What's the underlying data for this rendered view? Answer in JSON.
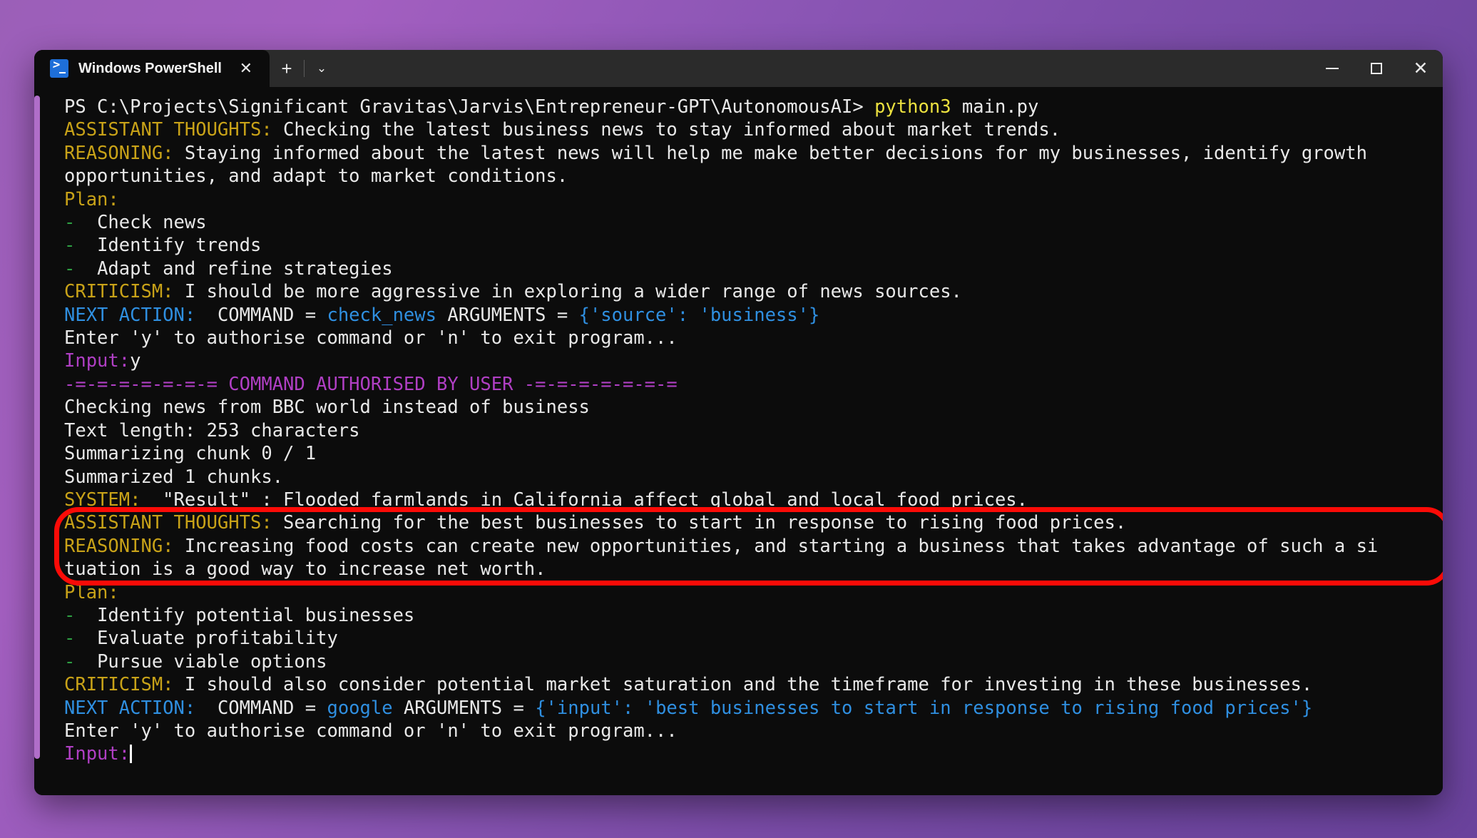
{
  "window": {
    "tab_title": "Windows PowerShell",
    "tab_close_label": "✕",
    "new_tab_label": "+",
    "dropdown_label": "⌄",
    "minimize_label": "",
    "maximize_label": "",
    "close_label": "✕"
  },
  "colors": {
    "desktop_purple": "#8a55b4",
    "terminal_background": "#0c0c0c",
    "titlebar_background": "#2b2b2b",
    "scrollbar_thumb": "#b06ec9",
    "annotation_red": "#fb0b07",
    "text_white": "#e8e8e8",
    "label_yellow": "#c8a218",
    "bright_yellow": "#ece13f",
    "bullet_green": "#2ea043",
    "command_blue": "#2f8fe0",
    "input_magenta": "#b03fc4"
  },
  "terminal": {
    "lines": [
      {
        "id": "prompt-line",
        "segments": [
          {
            "text": "PS C:\\Projects\\Significant Gravitas\\Jarvis\\Entrepreneur-GPT\\AutonomousAI> ",
            "color": "white"
          },
          {
            "text": "python3",
            "color": "byellow"
          },
          {
            "text": " main.py",
            "color": "white"
          }
        ]
      },
      {
        "id": "assistant-thoughts-1",
        "segments": [
          {
            "text": "ASSISTANT THOUGHTS:",
            "color": "yellow"
          },
          {
            "text": " Checking the latest business news to stay informed about market trends.",
            "color": "white"
          }
        ]
      },
      {
        "id": "reasoning-1",
        "segments": [
          {
            "text": "REASONING:",
            "color": "yellow"
          },
          {
            "text": " Staying informed about the latest news will help me make better decisions for my businesses, identify growth",
            "color": "white"
          }
        ]
      },
      {
        "id": "reasoning-1-wrap",
        "segments": [
          {
            "text": "opportunities, and adapt to market conditions.",
            "color": "white"
          }
        ]
      },
      {
        "id": "plan-header-1",
        "segments": [
          {
            "text": "Plan:",
            "color": "yellow"
          }
        ]
      },
      {
        "id": "plan-item-1-1",
        "segments": [
          {
            "text": "-",
            "color": "green"
          },
          {
            "text": "  Check news",
            "color": "white"
          }
        ]
      },
      {
        "id": "plan-item-1-2",
        "segments": [
          {
            "text": "-",
            "color": "green"
          },
          {
            "text": "  Identify trends",
            "color": "white"
          }
        ]
      },
      {
        "id": "plan-item-1-3",
        "segments": [
          {
            "text": "-",
            "color": "green"
          },
          {
            "text": "  Adapt and refine strategies",
            "color": "white"
          }
        ]
      },
      {
        "id": "criticism-1",
        "segments": [
          {
            "text": "CRITICISM:",
            "color": "yellow"
          },
          {
            "text": " I should be more aggressive in exploring a wider range of news sources.",
            "color": "white"
          }
        ]
      },
      {
        "id": "next-action-1",
        "segments": [
          {
            "text": "NEXT ACTION:",
            "color": "blue"
          },
          {
            "text": "  COMMAND = ",
            "color": "white"
          },
          {
            "text": "check_news",
            "color": "blue"
          },
          {
            "text": " ARGUMENTS = ",
            "color": "white"
          },
          {
            "text": "{'source': 'business'}",
            "color": "blue"
          }
        ]
      },
      {
        "id": "authorise-prompt-1",
        "segments": [
          {
            "text": "Enter 'y' to authorise command or 'n' to exit program...",
            "color": "white"
          }
        ]
      },
      {
        "id": "input-line-1",
        "segments": [
          {
            "text": "Input:",
            "color": "magenta"
          },
          {
            "text": "y",
            "color": "white"
          }
        ]
      },
      {
        "id": "command-authorised-banner",
        "segments": [
          {
            "text": "-=-=-=-=-=-=-= COMMAND AUTHORISED BY USER -=-=-=-=-=-=-=",
            "color": "magenta"
          }
        ]
      },
      {
        "id": "checking-news-output",
        "segments": [
          {
            "text": "Checking news from BBC world instead of business",
            "color": "white"
          }
        ]
      },
      {
        "id": "text-length-output",
        "segments": [
          {
            "text": "Text length: 253 characters",
            "color": "white"
          }
        ]
      },
      {
        "id": "summarizing-chunk-output",
        "segments": [
          {
            "text": "Summarizing chunk 0 / 1",
            "color": "white"
          }
        ]
      },
      {
        "id": "summarized-output",
        "segments": [
          {
            "text": "Summarized 1 chunks.",
            "color": "white"
          }
        ]
      },
      {
        "id": "system-result",
        "segments": [
          {
            "text": "SYSTEM:",
            "color": "yellow"
          },
          {
            "text": "  \"Result\" : Flooded farmlands in California affect global and local food prices.",
            "color": "white"
          }
        ]
      },
      {
        "id": "assistant-thoughts-2",
        "segments": [
          {
            "text": "ASSISTANT THOUGHTS:",
            "color": "yellow"
          },
          {
            "text": " Searching for the best businesses to start in response to rising food prices.",
            "color": "white"
          }
        ]
      },
      {
        "id": "reasoning-2",
        "segments": [
          {
            "text": "REASONING:",
            "color": "yellow"
          },
          {
            "text": " Increasing food costs can create new opportunities, and starting a business that takes advantage of such a si",
            "color": "white"
          }
        ]
      },
      {
        "id": "reasoning-2-wrap",
        "segments": [
          {
            "text": "tuation is a good way to increase net worth.",
            "color": "white"
          }
        ]
      },
      {
        "id": "plan-header-2",
        "segments": [
          {
            "text": "Plan:",
            "color": "yellow"
          }
        ]
      },
      {
        "id": "plan-item-2-1",
        "segments": [
          {
            "text": "-",
            "color": "green"
          },
          {
            "text": "  Identify potential businesses",
            "color": "white"
          }
        ]
      },
      {
        "id": "plan-item-2-2",
        "segments": [
          {
            "text": "-",
            "color": "green"
          },
          {
            "text": "  Evaluate profitability",
            "color": "white"
          }
        ]
      },
      {
        "id": "plan-item-2-3",
        "segments": [
          {
            "text": "-",
            "color": "green"
          },
          {
            "text": "  Pursue viable options",
            "color": "white"
          }
        ]
      },
      {
        "id": "criticism-2",
        "segments": [
          {
            "text": "CRITICISM:",
            "color": "yellow"
          },
          {
            "text": " I should also consider potential market saturation and the timeframe for investing in these businesses.",
            "color": "white"
          }
        ]
      },
      {
        "id": "next-action-2",
        "segments": [
          {
            "text": "NEXT ACTION:",
            "color": "blue"
          },
          {
            "text": "  COMMAND = ",
            "color": "white"
          },
          {
            "text": "google",
            "color": "blue"
          },
          {
            "text": " ARGUMENTS = ",
            "color": "white"
          },
          {
            "text": "{'input': 'best businesses to start in response to rising food prices'}",
            "color": "blue"
          }
        ]
      },
      {
        "id": "authorise-prompt-2",
        "segments": [
          {
            "text": "Enter 'y' to authorise command or 'n' to exit program...",
            "color": "white"
          }
        ]
      },
      {
        "id": "input-line-2",
        "segments": [
          {
            "text": "Input:",
            "color": "magenta"
          }
        ],
        "cursor": true
      }
    ]
  },
  "annotation": {
    "shape": "rounded-rectangle",
    "color": "#fb0b07",
    "highlights": [
      "assistant-thoughts-2",
      "reasoning-2",
      "reasoning-2-wrap"
    ]
  }
}
